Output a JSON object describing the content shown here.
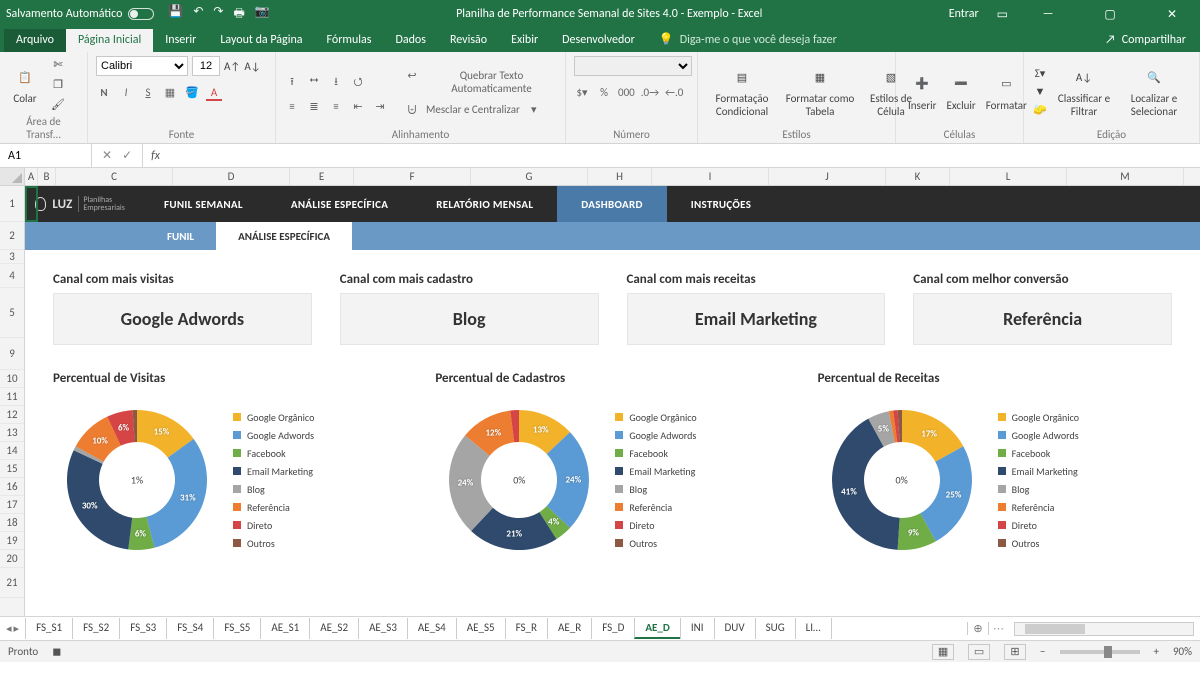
{
  "titlebar": {
    "autosave": "Salvamento Automático",
    "title": "Planilha de Performance Semanal de Sites 4.0 - Exemplo  -  Excel",
    "signin": "Entrar"
  },
  "ribbontabs": {
    "file": "Arquivo",
    "home": "Página Inicial",
    "insert": "Inserir",
    "layout": "Layout da Página",
    "formulas": "Fórmulas",
    "data": "Dados",
    "review": "Revisão",
    "view": "Exibir",
    "developer": "Desenvolvedor",
    "tellme": "Diga-me o que você deseja fazer",
    "share": "Compartilhar"
  },
  "ribbon": {
    "clipboard": {
      "paste": "Colar",
      "label": "Área de Transf…"
    },
    "font": {
      "name": "Calibri",
      "size": "12",
      "label": "Fonte",
      "bold": "N",
      "italic": "I",
      "underline": "S"
    },
    "alignment": {
      "wrap": "Quebrar Texto Automaticamente",
      "merge": "Mesclar e Centralizar",
      "label": "Alinhamento"
    },
    "number": {
      "label": "Número"
    },
    "styles": {
      "cond": "Formatação Condicional",
      "table": "Formatar como Tabela",
      "cell": "Estilos de Célula",
      "label": "Estilos"
    },
    "cells": {
      "insert": "Inserir",
      "delete": "Excluir",
      "format": "Formatar",
      "label": "Células"
    },
    "editing": {
      "sort": "Classificar e Filtrar",
      "find": "Localizar e Selecionar",
      "label": "Edição"
    }
  },
  "namebox": "A1",
  "columns": [
    "A",
    "B",
    "C",
    "D",
    "E",
    "F",
    "G",
    "H",
    "I",
    "J",
    "K",
    "L",
    "M"
  ],
  "rows": [
    "1",
    "2",
    "3",
    "4",
    "5",
    "9",
    "10",
    "11",
    "12",
    "13",
    "14",
    "15",
    "16",
    "17",
    "18",
    "19",
    "20",
    "21"
  ],
  "dashnav": {
    "brand": "LUZ",
    "brand_sub": "Planilhas Empresariais",
    "items": [
      "FUNIL SEMANAL",
      "ANÁLISE ESPECÍFICA",
      "RELATÓRIO MENSAL",
      "DASHBOARD",
      "INSTRUÇÕES"
    ],
    "sub": [
      "FUNIL",
      "ANÁLISE ESPECÍFICA"
    ]
  },
  "cards": [
    {
      "hd": "Canal com mais visitas",
      "val": "Google Adwords"
    },
    {
      "hd": "Canal com mais cadastro",
      "val": "Blog"
    },
    {
      "hd": "Canal com mais receitas",
      "val": "Email Marketing"
    },
    {
      "hd": "Canal com melhor conversão",
      "val": "Referência"
    }
  ],
  "legend": [
    "Google Orgânico",
    "Google Adwords",
    "Facebook",
    "Email Marketing",
    "Blog",
    "Referência",
    "Direto",
    "Outros"
  ],
  "colors": {
    "Google Orgânico": "#f2b32b",
    "Google Adwords": "#5b9bd5",
    "Facebook": "#70ad47",
    "Email Marketing": "#2f4a6d",
    "Blog": "#a5a5a5",
    "Referência": "#ed7d31",
    "Direto": "#d64545",
    "Outros": "#8c5a44"
  },
  "chart_data": [
    {
      "type": "donut",
      "title": "Percentual de Visitas",
      "center_label": "1%",
      "series": [
        {
          "name": "Google Orgânico",
          "value": 15
        },
        {
          "name": "Google Adwords",
          "value": 31
        },
        {
          "name": "Facebook",
          "value": 6
        },
        {
          "name": "Email Marketing",
          "value": 30
        },
        {
          "name": "Blog",
          "value": 1
        },
        {
          "name": "Referência",
          "value": 10
        },
        {
          "name": "Direto",
          "value": 6
        },
        {
          "name": "Outros",
          "value": 1
        }
      ]
    },
    {
      "type": "donut",
      "title": "Percentual de Cadastros",
      "center_label": "0%",
      "series": [
        {
          "name": "Google Orgânico",
          "value": 13
        },
        {
          "name": "Google Adwords",
          "value": 24
        },
        {
          "name": "Facebook",
          "value": 4
        },
        {
          "name": "Email Marketing",
          "value": 21
        },
        {
          "name": "Blog",
          "value": 24
        },
        {
          "name": "Referência",
          "value": 12
        },
        {
          "name": "Direto",
          "value": 2
        },
        {
          "name": "Outros",
          "value": 0
        }
      ]
    },
    {
      "type": "donut",
      "title": "Percentual de Receitas",
      "center_label": "0%",
      "series": [
        {
          "name": "Google Orgânico",
          "value": 17
        },
        {
          "name": "Google Adwords",
          "value": 25
        },
        {
          "name": "Facebook",
          "value": 9
        },
        {
          "name": "Email Marketing",
          "value": 41
        },
        {
          "name": "Blog",
          "value": 5
        },
        {
          "name": "Referência",
          "value": 1
        },
        {
          "name": "Direto",
          "value": 1
        },
        {
          "name": "Outros",
          "value": 1
        }
      ]
    }
  ],
  "sheettabs": [
    "FS_S1",
    "FS_S2",
    "FS_S3",
    "FS_S4",
    "FS_S5",
    "AE_S1",
    "AE_S2",
    "AE_S3",
    "AE_S4",
    "AE_S5",
    "FS_R",
    "AE_R",
    "FS_D",
    "AE_D",
    "INI",
    "DUV",
    "SUG",
    "LI…"
  ],
  "active_sheet": "AE_D",
  "status": {
    "ready": "Pronto",
    "zoom": "90%"
  }
}
